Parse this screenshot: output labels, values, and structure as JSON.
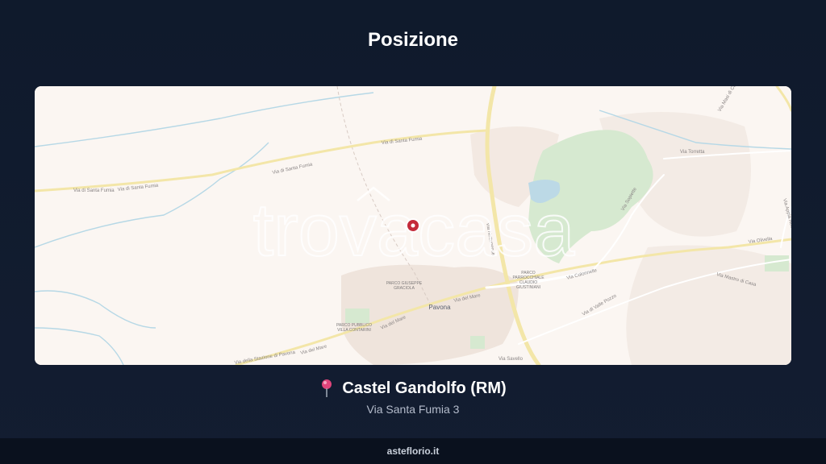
{
  "header": {
    "title": "Posizione"
  },
  "map": {
    "watermark": "trovacasa",
    "labels": {
      "road_santa_fumia_top": "Via di Santa Fumia",
      "road_santa_fumia_mid": "Via di Santa Fumia",
      "road_santa_fumia_left1": "Via di Santa Fumia",
      "road_santa_fumia_left2": "Via di Santa Fumia",
      "road_nettunense": "Via Nettunense",
      "road_torretta": "Via Torretta",
      "road_appia": "Via Appia Nuova",
      "road_sopiette": "Via Sopiette",
      "road_olivella": "Via Olivella",
      "road_colonnelle": "Via Colonnelle",
      "road_mastro": "Via Mastro di Casa",
      "road_valle_pozzo": "Via di Valle Pozzo",
      "road_del_mare1": "Via del Mare",
      "road_del_mare2": "Via del Mare",
      "road_del_mare3": "Via del Mare",
      "road_stazione": "Via della Stazione di Pavona",
      "road_savello": "Via Savello",
      "road_masi": "Via Masi di Castel",
      "park_giuseppe_line1": "PARCO GIUSEPPE",
      "park_giuseppe_line2": "GRACIOLA",
      "park_claudio_line1": "PARCO",
      "park_claudio_line2": "PARROCCHIALE",
      "park_claudio_line3": "CLAUDIO",
      "park_claudio_line4": "GIUSTINIANI",
      "park_villa_line1": "PARCO PUBBLICO",
      "park_villa_line2": "VILLA CONTARINI",
      "town_pavona": "Pavona"
    }
  },
  "location": {
    "title": "Castel Gandolfo (RM)",
    "address": "Via Santa Fumia 3"
  },
  "footer": {
    "brand": "asteflorio.it"
  },
  "colors": {
    "background": "#0f1a2c",
    "map_land": "#fbf6f2",
    "park_green": "#d6e9d0",
    "road_yellow": "#f3e6a8",
    "marker_red": "#c42b3a",
    "pin_pink": "#e0457b"
  }
}
